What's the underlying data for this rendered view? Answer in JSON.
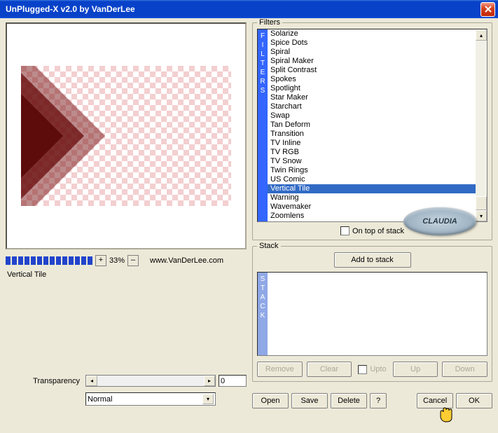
{
  "window": {
    "title": "UnPlugged-X v2.0 by VanDerLee"
  },
  "preview": {
    "zoom_label": "33%",
    "url": "www.VanDerLee.com",
    "selected_filter_label": "Vertical Tile"
  },
  "params": {
    "transparency_label": "Transparency",
    "transparency_value": "0",
    "blend_mode": "Normal"
  },
  "filters": {
    "legend": "Filters",
    "tab_label": "FILTERS",
    "items": [
      "Solarize",
      "Spice Dots",
      "Spiral",
      "Spiral Maker",
      "Split Contrast",
      "Spokes",
      "Spotlight",
      "Star Maker",
      "Starchart",
      "Swap",
      "Tan Deform",
      "Transition",
      "TV Inline",
      "TV RGB",
      "TV Snow",
      "Twin Rings",
      "US Comic",
      "Vertical Tile",
      "Warning",
      "Wavemaker",
      "Zoomlens"
    ],
    "selected_index": 17,
    "ontop_label": "On top of stack",
    "watermark_text": "CLAUDIA"
  },
  "stack": {
    "legend": "Stack",
    "tab_label": "STACK",
    "add_label": "Add to stack",
    "remove_label": "Remove",
    "clear_label": "Clear",
    "upto_label": "Upto",
    "up_label": "Up",
    "down_label": "Down"
  },
  "footer": {
    "open": "Open",
    "save": "Save",
    "delete": "Delete",
    "help": "?",
    "cancel": "Cancel",
    "ok": "OK"
  }
}
